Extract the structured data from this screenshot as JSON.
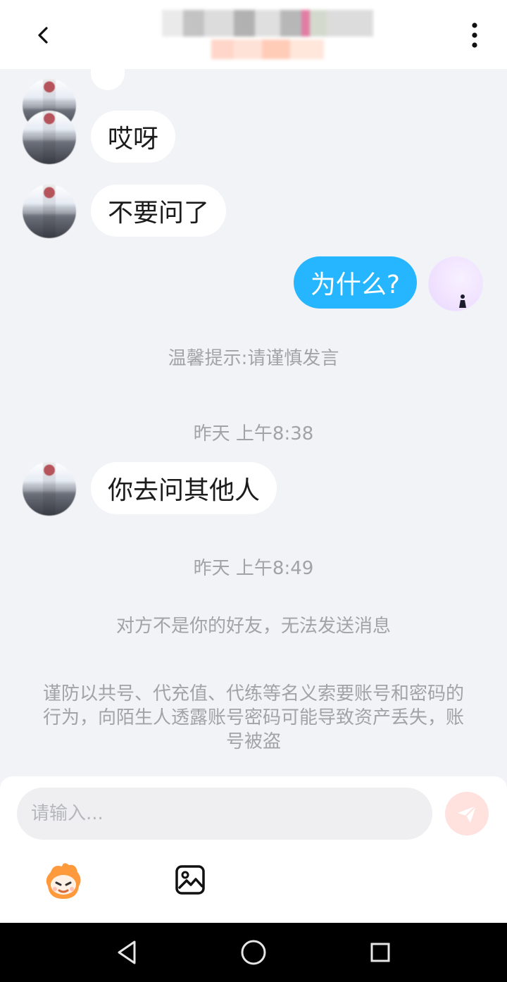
{
  "header": {
    "back_icon": "chevron-left-icon",
    "more_icon": "more-vertical-icon"
  },
  "messages": {
    "top_partial": {
      "text": ""
    },
    "incoming_1": {
      "text": "哎呀"
    },
    "incoming_2": {
      "text": "不要问了"
    },
    "outgoing_1": {
      "text": "为什么?"
    },
    "system_tip": "温馨提示:请谨慎发言",
    "time_1": "昨天 上午8:38",
    "incoming_3": {
      "text": "你去问其他人"
    },
    "time_2": "昨天 上午8:49",
    "notice_1": "对方不是你的好友，无法发送消息",
    "notice_2": "谨防以共号、代充值、代练等名义索要账号和密码的行为，向陌生人透露账号密码可能导致资产丢失，账号被盗"
  },
  "composer": {
    "placeholder": "请输入...",
    "send_icon": "send-icon",
    "emoji_icon": "emoji-mascot-icon",
    "image_icon": "image-icon",
    "send_color": "#ffe1de"
  },
  "colors": {
    "outgoing_bubble": "#26b6ff",
    "incoming_bubble": "#ffffff",
    "background": "#f2f3f7"
  },
  "system_nav": {
    "back_icon": "triangle-back-icon",
    "home_icon": "circle-home-icon",
    "recent_icon": "square-recent-icon"
  }
}
